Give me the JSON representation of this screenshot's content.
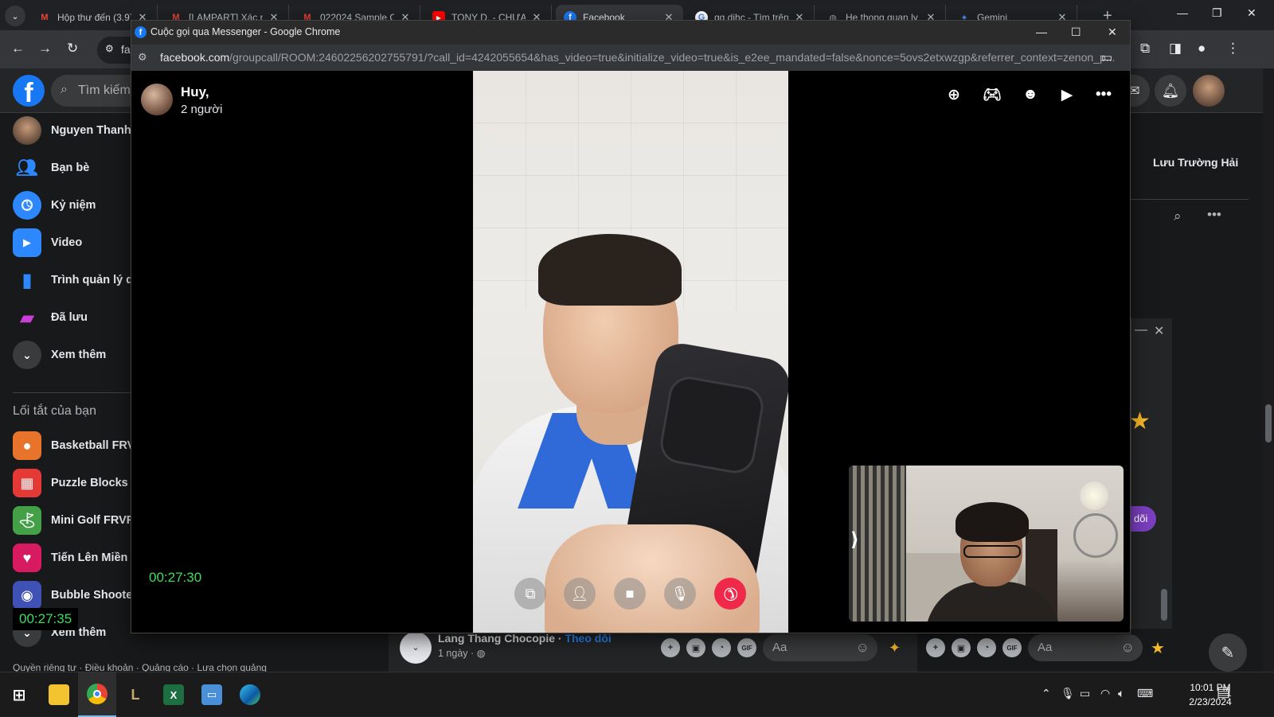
{
  "browser": {
    "tabs": [
      {
        "label": "Hộp thư đến (3.97",
        "favicon": "gmail-icon",
        "favicon_color": "#ea4335"
      },
      {
        "label": "[LAMPART] Xác nh",
        "favicon": "gmail-icon",
        "favicon_color": "#ea4335"
      },
      {
        "label": "022024 Sample C",
        "favicon": "gmail-icon",
        "favicon_color": "#ea4335"
      },
      {
        "label": "TONY D. - CHƯA F",
        "favicon": "youtube-icon",
        "favicon_color": "#ff0000"
      },
      {
        "label": "Facebook",
        "favicon": "facebook-icon",
        "favicon_color": "#1877f2",
        "active": true
      },
      {
        "label": "qq dihc - Tìm trên",
        "favicon": "google-icon",
        "favicon_color": "#4285f4"
      },
      {
        "label": "He thong quan ly",
        "favicon": "globe-icon",
        "favicon_color": "#9aa0a6"
      },
      {
        "label": "Gemini",
        "favicon": "gemini-icon",
        "favicon_color": "#4c8df6"
      }
    ],
    "omnibox_partial": "fa"
  },
  "popup": {
    "window_title": "Cuộc gọi qua Messenger - Google Chrome",
    "url_host": "facebook.com",
    "url_rest": "/groupcall/ROOM:24602256202755791/?call_id=4242055654&has_video=true&initialize_video=true&is_e2ee_mandated=false&nonce=5ovs2etxwzgp&referrer_context=zenon_p...",
    "group_name": "Huy,",
    "participants": "2 người",
    "call_timer": "00:27:30",
    "top_icons": [
      "add-icon",
      "game-controller-icon",
      "add-emoji-icon",
      "share-screen-icon",
      "more-icon"
    ],
    "controls": [
      "screen-share-icon",
      "add-person-icon",
      "video-camera-icon",
      "microphone-icon",
      "end-call-icon"
    ]
  },
  "facebook": {
    "search_placeholder": "Tìm kiếm t",
    "sidebar": {
      "items": [
        {
          "label": "Nguyen Thanh T",
          "icon": "profile-avatar"
        },
        {
          "label": "Bạn bè",
          "icon": "friends-icon"
        },
        {
          "label": "Kỷ niệm",
          "icon": "memories-clock-icon"
        },
        {
          "label": "Video",
          "icon": "video-play-icon"
        },
        {
          "label": "Trình quản lý qu",
          "icon": "ads-manager-chart-icon"
        },
        {
          "label": "Đã lưu",
          "icon": "bookmark-icon"
        },
        {
          "label": "Xem thêm",
          "icon": "chevron-down-icon"
        }
      ],
      "shortcuts_heading": "Lối tắt của bạn",
      "shortcuts": [
        {
          "label": "Basketball FRVR",
          "color": "#e8742b"
        },
        {
          "label": "Puzzle Blocks Cla",
          "color": "#e53935"
        },
        {
          "label": "Mini Golf FRVR",
          "color": "#43a047"
        },
        {
          "label": "Tiến Lên Miền N",
          "color": "#d81b60"
        },
        {
          "label": "Bubble Shooter",
          "color": "#3f51b5"
        }
      ],
      "shortcuts_more": "Xem thêm",
      "footer": "Quyền riêng tư · Điều khoản · Quảng cáo · Lựa chọn quảng",
      "overlay_timer": "00:27:35"
    },
    "right_panel": {
      "contact_name": "Lưu Trường Hải",
      "follow_pill": "dõi"
    },
    "post": {
      "author": "Lang Thang Chocopie",
      "follow": "Theo dõi",
      "time": "1 ngày ·"
    },
    "composer": {
      "placeholder_1": "Aa",
      "placeholder_2": "Aa",
      "gif": "GIF"
    }
  },
  "taskbar": {
    "apps": [
      "windows-start-icon",
      "file-explorer-icon",
      "chrome-icon",
      "league-icon",
      "excel-icon",
      "remote-desktop-icon",
      "edge-icon"
    ],
    "time": "10:01 PM",
    "date": "2/23/2024",
    "notification_count": "1"
  }
}
